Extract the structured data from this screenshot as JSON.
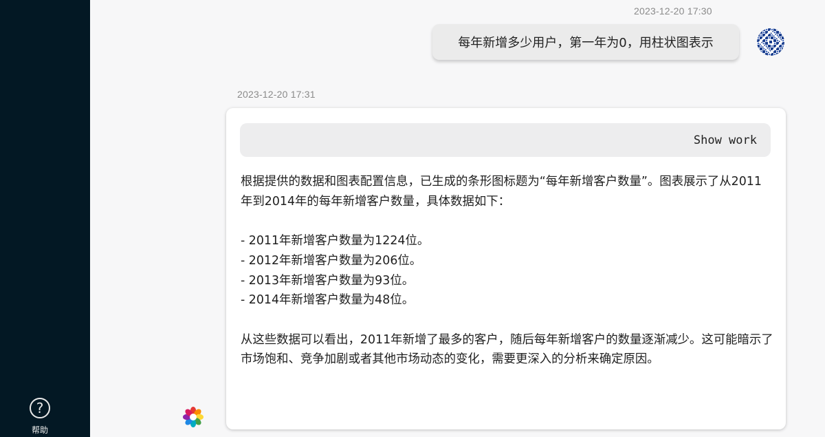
{
  "sidebar": {
    "help": {
      "icon": "question-circle-icon",
      "label": "帮助"
    }
  },
  "conversation": {
    "user_message": {
      "timestamp": "2023-12-20 17:30",
      "text": "每年新增多少用户，第一年为0，用柱状图表示",
      "avatar_icon": "user-avatar-pattern-icon"
    },
    "bot_message": {
      "timestamp": "2023-12-20 17:31",
      "show_work_label": "Show work",
      "avatar_icon": "bot-logo-flower-icon",
      "intro": "根据提供的数据和图表配置信息，已生成的条形图标题为“每年新增客户数量”。图表展示了从2011年到2014年的每年新增客户数量，具体数据如下：",
      "items": [
        "- 2011年新增客户数量为1224位。",
        "- 2012年新增客户数量为206位。",
        "- 2013年新增客户数量为93位。",
        "- 2014年新增客户数量为48位。"
      ],
      "conclusion": "从这些数据可以看出，2011年新增了最多的客户，随后每年新增客户的数量逐渐减少。这可能暗示了市场饱和、竞争加剧或者其他市场动态的变化，需要更深入的分析来确定原因。"
    }
  },
  "colors": {
    "sidebar_bg": "#031824",
    "page_bg": "#f7f7f8",
    "user_bubble_bg": "#ebebeb",
    "card_bg": "#ffffff",
    "show_work_bg": "#ededee"
  }
}
